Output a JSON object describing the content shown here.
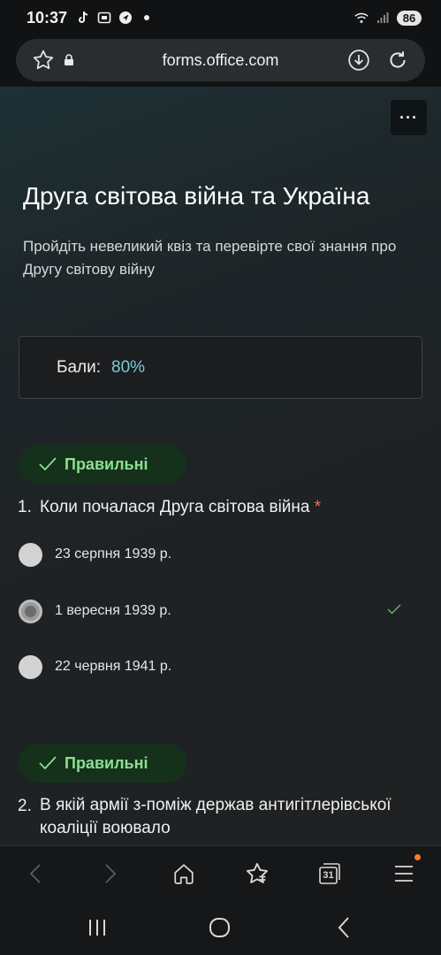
{
  "status_bar": {
    "time": "10:37",
    "battery": "86"
  },
  "browser": {
    "url": "forms.office.com",
    "tab_count": "31"
  },
  "form": {
    "more_button": "···",
    "title": "Друга світова війна та Україна",
    "description": "Пройдіть невеликий квіз та перевірте свої знання про Другу світову війну",
    "score_label": "Бали:",
    "score_value": "80%"
  },
  "questions": [
    {
      "badge": "Правильні",
      "number": "1.",
      "text": "Коли почалася Друга світова війна",
      "required_mark": "*",
      "options": [
        {
          "label": "23 серпня 1939 р.",
          "selected": false
        },
        {
          "label": "1 вересня 1939 р.",
          "selected": true,
          "correct": true
        },
        {
          "label": "22 червня 1941 р.",
          "selected": false
        }
      ]
    },
    {
      "badge": "Правильні",
      "number": "2.",
      "text": "В якій армії з-поміж держав антигітлерівської коаліції воювало"
    }
  ],
  "colors": {
    "accent_score": "#7dc9d6",
    "badge_bg": "#15311c",
    "badge_text": "#8be08f",
    "required": "#e57373",
    "correct_check": "#5cb85c",
    "notification_dot": "#ff7a2f"
  },
  "icons": {
    "browser_nav": [
      "back-icon",
      "forward-icon",
      "home-icon",
      "bookmarks-icon",
      "tabs-icon",
      "menu-icon"
    ],
    "system_nav": [
      "recent-apps-icon",
      "home-circle-icon",
      "back-chevron-icon"
    ]
  }
}
